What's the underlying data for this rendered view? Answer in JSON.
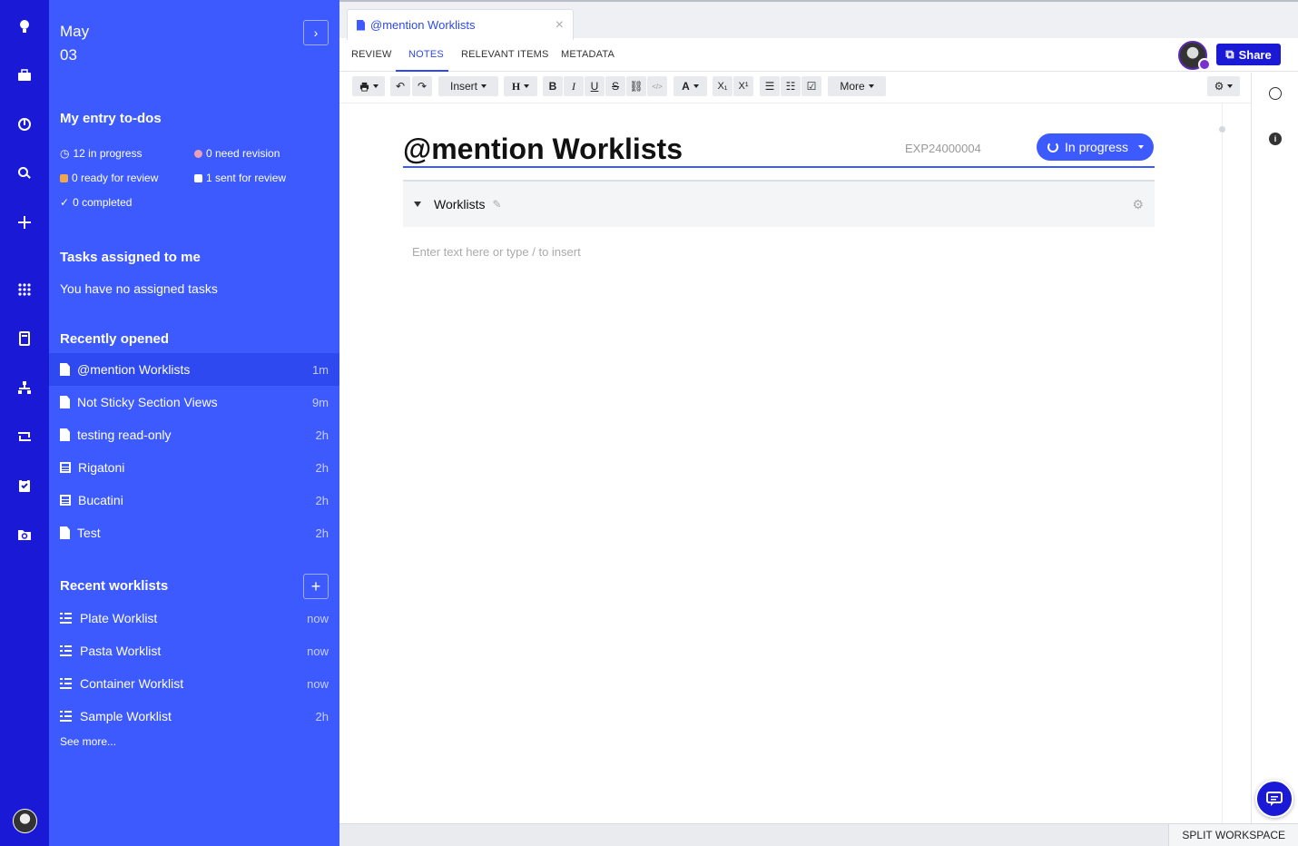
{
  "sidebar": {
    "date_month": "May",
    "date_day": "03",
    "todos_title": "My entry to-dos",
    "todos": {
      "in_progress": "12 in progress",
      "need_revision": "0 need revision",
      "ready_for_review": "0 ready for review",
      "sent_for_review": "1 sent for review",
      "completed": "0 completed"
    },
    "tasks_title": "Tasks assigned to me",
    "tasks_empty": "You have no assigned tasks",
    "recent_title": "Recently opened",
    "recent": [
      {
        "label": "@mention Worklists",
        "time": "1m",
        "icon": "document-icon"
      },
      {
        "label": "Not Sticky Section Views",
        "time": "9m",
        "icon": "document-icon"
      },
      {
        "label": "testing read-only",
        "time": "2h",
        "icon": "document-icon"
      },
      {
        "label": "Rigatoni",
        "time": "2h",
        "icon": "table-icon"
      },
      {
        "label": "Bucatini",
        "time": "2h",
        "icon": "table-icon"
      },
      {
        "label": "Test",
        "time": "2h",
        "icon": "document-icon"
      }
    ],
    "worklists_title": "Recent worklists",
    "worklists": [
      {
        "label": "Plate Worklist",
        "time": "now"
      },
      {
        "label": "Pasta Worklist",
        "time": "now"
      },
      {
        "label": "Container Worklist",
        "time": "now"
      },
      {
        "label": "Sample Worklist",
        "time": "2h"
      }
    ],
    "see_more": "See more..."
  },
  "tab": {
    "title": "@mention Worklists",
    "close": "×"
  },
  "nav": {
    "review": "REVIEW",
    "notes": "NOTES",
    "relevant": "RELEVANT ITEMS",
    "metadata": "METADATA"
  },
  "share_label": "Share",
  "toolbar": {
    "insert": "Insert",
    "heading": "H",
    "bold": "B",
    "italic": "I",
    "underline": "U",
    "strike": "S",
    "code": "</>",
    "font_color": "A",
    "subscript": "X₁",
    "superscript": "X¹",
    "more": "More"
  },
  "entry": {
    "title": "@mention Worklists",
    "id": "EXP24000004",
    "status": "In progress",
    "section_name": "Worklists",
    "placeholder": "Enter text here or type / to insert"
  },
  "footer": {
    "split": "SPLIT WORKSPACE"
  },
  "colors": {
    "rail": "#1a1ad6",
    "sidebar": "#3d5afe",
    "accent": "#2e49ef"
  }
}
